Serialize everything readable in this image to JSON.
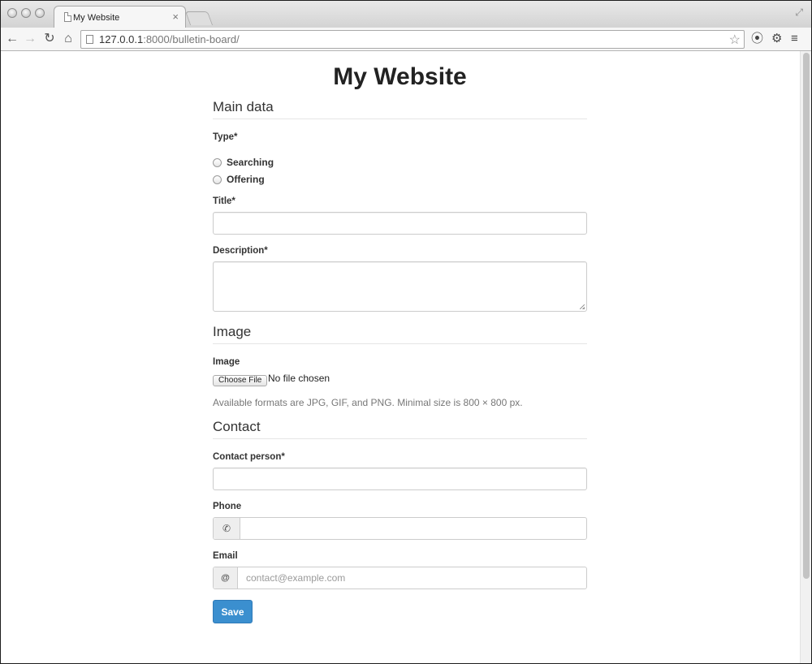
{
  "browser": {
    "tab_title": "My Website",
    "tab_close": "×",
    "url_host": "127.0.0.1",
    "url_rest": ":8000/bulletin-board/",
    "icons": [
      "back-icon",
      "forward-icon",
      "reload-icon",
      "home-icon",
      "star-icon",
      "extension-icon",
      "gear-icon",
      "menu-icon"
    ]
  },
  "page": {
    "site_title": "My Website",
    "sections": {
      "main": "Main data",
      "image": "Image",
      "contact": "Contact"
    },
    "type_field": {
      "label": "Type*",
      "options": [
        "Searching",
        "Offering"
      ]
    },
    "title_label": "Title*",
    "description_label": "Description*",
    "image_field": {
      "label": "Image",
      "button": "Choose File",
      "status": "No file chosen",
      "help": "Available formats are JPG, GIF, and PNG. Minimal size is 800 × 800 px."
    },
    "contact_person_label": "Contact person*",
    "phone_label": "Phone",
    "email_label": "Email",
    "email_addon": "@",
    "email_placeholder": "contact@example.com",
    "save_label": "Save"
  }
}
